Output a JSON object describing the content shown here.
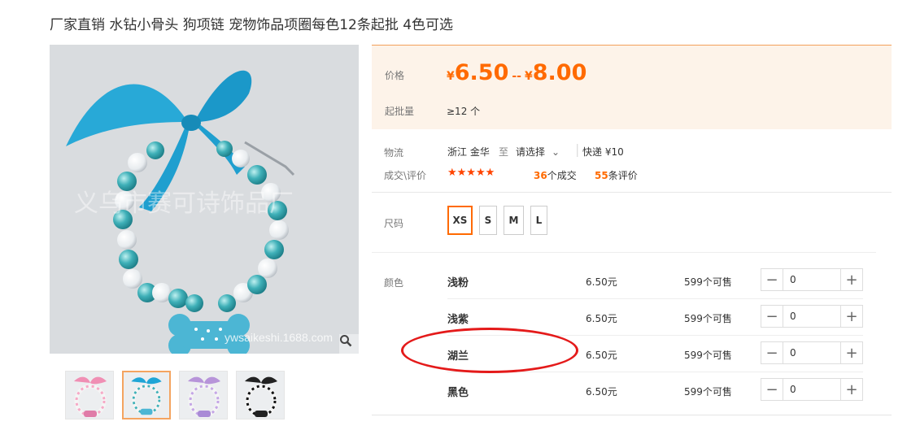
{
  "product": {
    "title": "厂家直销 水钻小骨头 狗项链 宠物饰品项圈每色12条起批 4色可选",
    "watermark": "义乌市赛可诗饰品厂",
    "watermark_url": "ywsaikeshi.1688.com"
  },
  "price_panel": {
    "price_label": "价格",
    "currency": "¥",
    "price_low": "6.50",
    "separator": "--",
    "price_high": "8.00",
    "moq_label": "起批量",
    "moq_value": "≥12 个"
  },
  "logistics": {
    "label": "物流",
    "origin": "浙江 金华",
    "to": "至",
    "destination": "请选择",
    "shipping": "快递 ¥10"
  },
  "reviews": {
    "label": "成交\\评价",
    "stars": "★★★★★",
    "deals_num": "36",
    "deals_unit": "个成交",
    "reviews_num": "55",
    "reviews_unit": "条评价"
  },
  "size": {
    "label": "尺码",
    "options": [
      "XS",
      "S",
      "M",
      "L"
    ],
    "selected": "XS"
  },
  "colors": {
    "label": "颜色",
    "rows": [
      {
        "name": "浅粉",
        "price": "6.50元",
        "stock": "599个可售",
        "qty": "0"
      },
      {
        "name": "浅紫",
        "price": "6.50元",
        "stock": "599个可售",
        "qty": "0"
      },
      {
        "name": "湖兰",
        "price": "6.50元",
        "stock": "599个可售",
        "qty": "0"
      },
      {
        "name": "黑色",
        "price": "6.50元",
        "stock": "599个可售",
        "qty": "0"
      }
    ]
  },
  "thumbnails": [
    "pink-collar",
    "blue-collar",
    "purple-collar",
    "black-collar"
  ],
  "colors_accent": {
    "orange": "#ff6a00",
    "highlight": "#e41a1a"
  }
}
